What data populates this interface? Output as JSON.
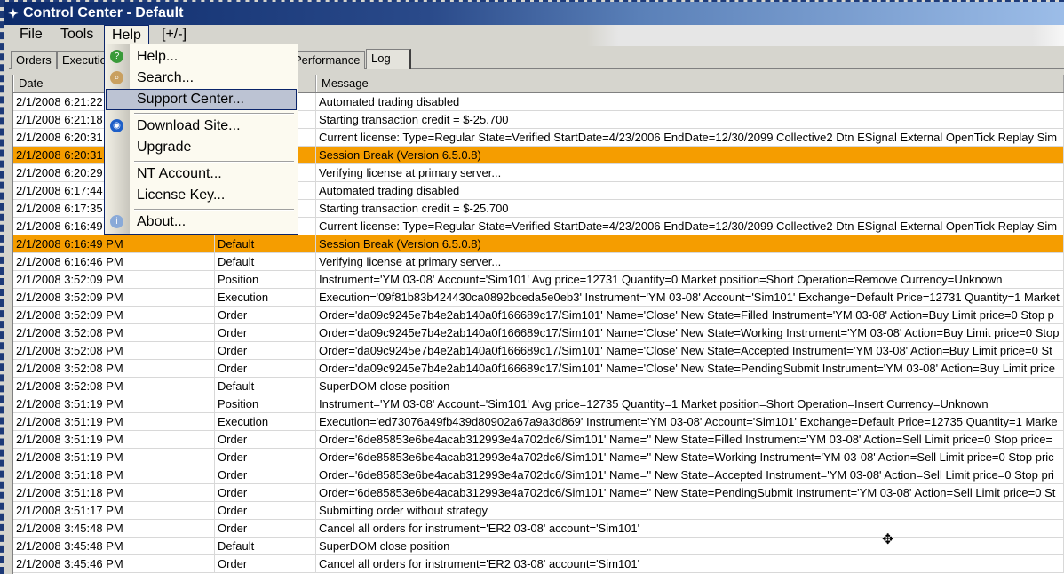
{
  "window": {
    "title": "Control Center - Default"
  },
  "menubar": [
    "File",
    "Tools",
    "Help",
    "[+/-]"
  ],
  "tabs": [
    "Orders",
    "Executio",
    "Performance",
    "Log"
  ],
  "columns": [
    "Date",
    "",
    "Message"
  ],
  "rows": [
    [
      "2/1/2008 6:21:22",
      "",
      "Automated trading disabled",
      false
    ],
    [
      "2/1/2008 6:21:18",
      "",
      "Starting transaction credit = $-25.700",
      false
    ],
    [
      "2/1/2008 6:20:31",
      "",
      "Current  license:  Type=Regular State=Verified StartDate=4/23/2006 EndDate=12/30/2099 Collective2 Dtn ESignal External OpenTick Replay Sim",
      false
    ],
    [
      "2/1/2008 6:20:31",
      "",
      "Session Break (Version 6.5.0.8)",
      true
    ],
    [
      "2/1/2008 6:20:29",
      "",
      "Verifying license at primary server...",
      false
    ],
    [
      "2/1/2008 6:17:44",
      "",
      "Automated trading disabled",
      false
    ],
    [
      "2/1/2008 6:17:35",
      "",
      "Starting transaction credit = $-25.700",
      false
    ],
    [
      "2/1/2008 6:16:49",
      "",
      "Current  license:  Type=Regular State=Verified StartDate=4/23/2006 EndDate=12/30/2099 Collective2 Dtn ESignal External OpenTick Replay Sim",
      false
    ],
    [
      "2/1/2008 6:16:49 PM",
      "Default",
      "Session Break (Version 6.5.0.8)",
      true
    ],
    [
      "2/1/2008 6:16:46 PM",
      "Default",
      "Verifying license at primary server...",
      false
    ],
    [
      "2/1/2008 3:52:09 PM",
      "Position",
      "Instrument='YM 03-08' Account='Sim101' Avg price=12731 Quantity=0 Market position=Short Operation=Remove Currency=Unknown",
      false
    ],
    [
      "2/1/2008 3:52:09 PM",
      "Execution",
      "Execution='09f81b83b424430ca0892bceda5e0eb3' Instrument='YM 03-08' Account='Sim101' Exchange=Default Price=12731 Quantity=1 Market",
      false
    ],
    [
      "2/1/2008 3:52:09 PM",
      "Order",
      "Order='da09c9245e7b4e2ab140a0f166689c17/Sim101' Name='Close' New State=Filled Instrument='YM 03-08' Action=Buy Limit price=0 Stop p",
      false
    ],
    [
      "2/1/2008 3:52:08 PM",
      "Order",
      "Order='da09c9245e7b4e2ab140a0f166689c17/Sim101' Name='Close' New State=Working Instrument='YM 03-08' Action=Buy Limit price=0 Stop",
      false
    ],
    [
      "2/1/2008 3:52:08 PM",
      "Order",
      "Order='da09c9245e7b4e2ab140a0f166689c17/Sim101' Name='Close' New State=Accepted Instrument='YM 03-08' Action=Buy Limit price=0 St",
      false
    ],
    [
      "2/1/2008 3:52:08 PM",
      "Order",
      "Order='da09c9245e7b4e2ab140a0f166689c17/Sim101' Name='Close' New State=PendingSubmit Instrument='YM 03-08' Action=Buy Limit price",
      false
    ],
    [
      "2/1/2008 3:52:08 PM",
      "Default",
      "SuperDOM close position",
      false
    ],
    [
      "2/1/2008 3:51:19 PM",
      "Position",
      "Instrument='YM 03-08' Account='Sim101' Avg price=12735 Quantity=1 Market position=Short Operation=Insert Currency=Unknown",
      false
    ],
    [
      "2/1/2008 3:51:19 PM",
      "Execution",
      "Execution='ed73076a49fb439d80902a67a9a3d869' Instrument='YM 03-08' Account='Sim101' Exchange=Default Price=12735 Quantity=1 Marke",
      false
    ],
    [
      "2/1/2008 3:51:19 PM",
      "Order",
      "Order='6de85853e6be4acab312993e4a702dc6/Sim101' Name='' New State=Filled Instrument='YM 03-08' Action=Sell Limit price=0 Stop price=",
      false
    ],
    [
      "2/1/2008 3:51:19 PM",
      "Order",
      "Order='6de85853e6be4acab312993e4a702dc6/Sim101' Name='' New State=Working Instrument='YM 03-08' Action=Sell Limit price=0 Stop pric",
      false
    ],
    [
      "2/1/2008 3:51:18 PM",
      "Order",
      "Order='6de85853e6be4acab312993e4a702dc6/Sim101' Name='' New State=Accepted Instrument='YM 03-08' Action=Sell Limit price=0 Stop pri",
      false
    ],
    [
      "2/1/2008 3:51:18 PM",
      "Order",
      "Order='6de85853e6be4acab312993e4a702dc6/Sim101' Name='' New State=PendingSubmit Instrument='YM 03-08' Action=Sell Limit price=0 St",
      false
    ],
    [
      "2/1/2008 3:51:17 PM",
      "Order",
      "Submitting order without strategy",
      false
    ],
    [
      "2/1/2008 3:45:48 PM",
      "Order",
      "Cancel all orders for instrument='ER2 03-08' account='Sim101'",
      false
    ],
    [
      "2/1/2008 3:45:48 PM",
      "Default",
      "SuperDOM close position",
      false
    ],
    [
      "2/1/2008 3:45:46 PM",
      "Order",
      "Cancel all orders for instrument='ER2 03-08' account='Sim101'",
      false
    ]
  ],
  "help_menu": [
    {
      "label": "Help...",
      "icon": "help-icon"
    },
    {
      "label": "Search...",
      "icon": "search-icon"
    },
    {
      "label": "Support Center...",
      "icon": ""
    },
    {
      "label": "Download Site...",
      "icon": "globe-icon"
    },
    {
      "label": "Upgrade",
      "icon": ""
    },
    {
      "label": "NT Account...",
      "icon": ""
    },
    {
      "label": "License Key...",
      "icon": ""
    },
    {
      "label": "About...",
      "icon": "info-icon"
    }
  ],
  "colors": {
    "session_break": "#f59d00",
    "menu_highlight": "#bcc3d3",
    "title_bar": "#0c2a6a"
  }
}
